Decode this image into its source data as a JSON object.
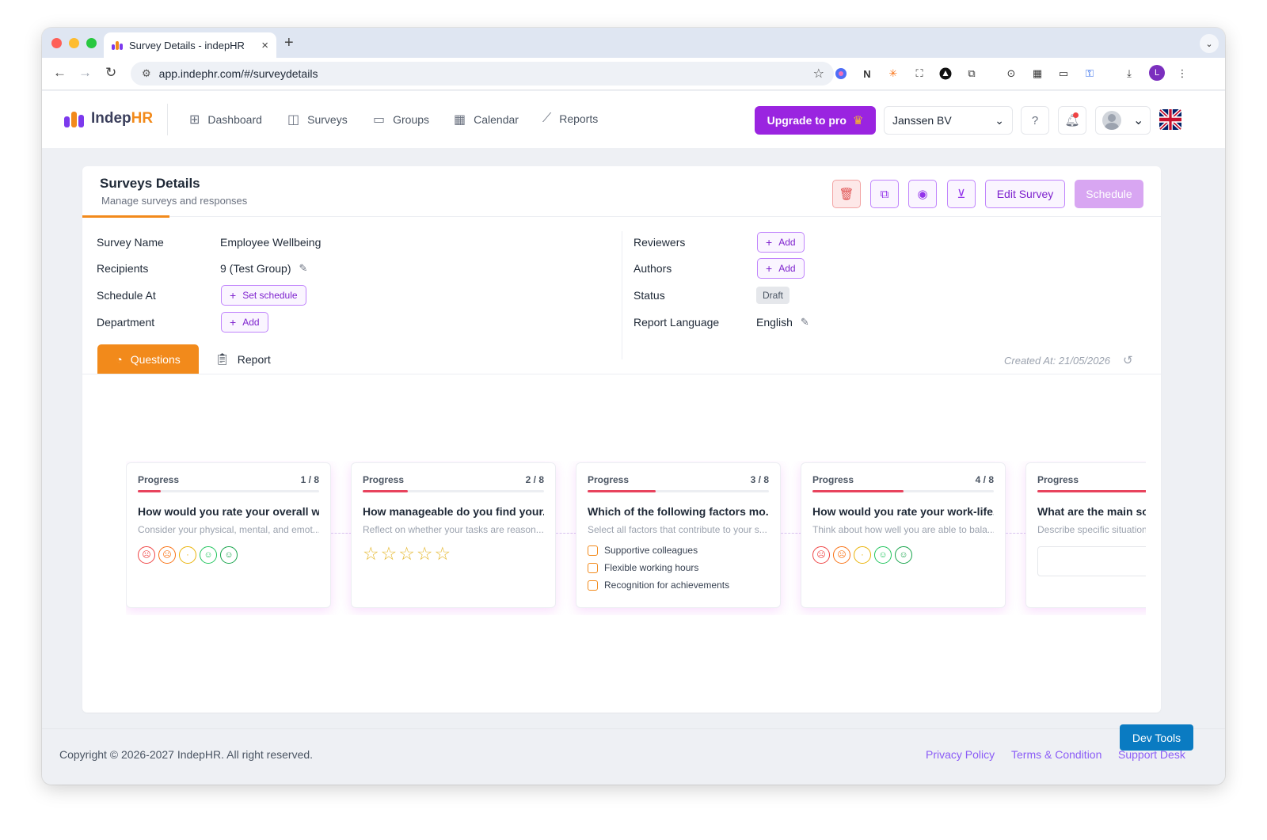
{
  "browser": {
    "tab_title": "Survey Details - indepHR",
    "tab_close": "×",
    "new_tab": "+",
    "url": "app.indephr.com/#/surveydetails",
    "profile_initial": "L"
  },
  "app": {
    "logo_part1": "Indep",
    "logo_part2": "HR",
    "nav": [
      {
        "label": "Dashboard",
        "icon": "dashboard-icon"
      },
      {
        "label": "Surveys",
        "icon": "surveys-icon"
      },
      {
        "label": "Groups",
        "icon": "folder-icon"
      },
      {
        "label": "Calendar",
        "icon": "calendar-icon"
      },
      {
        "label": "Reports",
        "icon": "chart-line-icon"
      }
    ],
    "upgrade_label": "Upgrade to pro",
    "company": "Janssen BV"
  },
  "card": {
    "title": "Surveys Details",
    "subtitle": "Manage surveys and responses",
    "edit_label": "Edit Survey",
    "schedule_label": "Schedule"
  },
  "details": {
    "survey_name_label": "Survey Name",
    "survey_name": "Employee Wellbeing",
    "recipients_label": "Recipients",
    "recipients": "9 (Test Group)",
    "schedule_at_label": "Schedule At",
    "set_schedule": "Set schedule",
    "department_label": "Department",
    "add": "Add",
    "reviewers_label": "Reviewers",
    "authors_label": "Authors",
    "status_label": "Status",
    "status": "Draft",
    "report_language_label": "Report Language",
    "report_language": "English"
  },
  "tabs": {
    "questions": "Questions",
    "report": "Report",
    "created_at": "Created At:  21/05/2026"
  },
  "questions": [
    {
      "progress_label": "Progress",
      "count": "1 / 8",
      "progress": 0.125,
      "title": "How would you rate your overall w...",
      "desc": "Consider your physical, mental, and emot...",
      "type": "faces"
    },
    {
      "progress_label": "Progress",
      "count": "2 / 8",
      "progress": 0.25,
      "title": "How manageable do you find your...",
      "desc": "Reflect on whether your tasks are reason...",
      "type": "stars"
    },
    {
      "progress_label": "Progress",
      "count": "3 / 8",
      "progress": 0.375,
      "title": "Which of the following factors mo...",
      "desc": "Select all factors that contribute to your s...",
      "type": "checkbox",
      "options": [
        "Supportive colleagues",
        "Flexible working hours",
        "Recognition for achievements"
      ]
    },
    {
      "progress_label": "Progress",
      "count": "4 / 8",
      "progress": 0.5,
      "title": "How would you rate your work-life...",
      "desc": "Think about how well you are able to bala...",
      "type": "faces"
    },
    {
      "progress_label": "Progress",
      "count": "",
      "progress": 0.625,
      "title": "What are the main sou",
      "desc": "Describe specific situation",
      "type": "text"
    }
  ],
  "footer": {
    "copyright": "Copyright © 2026-2027 IndepHR. All right reserved.",
    "privacy": "Privacy Policy",
    "terms": "Terms & Condition",
    "support": "Support Desk",
    "devtools": "Dev Tools"
  },
  "colors": {
    "accent_orange": "#f28a1b",
    "brand_purple": "#9a24e0",
    "progress_red": "#e8435d",
    "face_colors": [
      "#ef4444",
      "#f97316",
      "#eab308",
      "#22c55e",
      "#16a34a"
    ]
  }
}
